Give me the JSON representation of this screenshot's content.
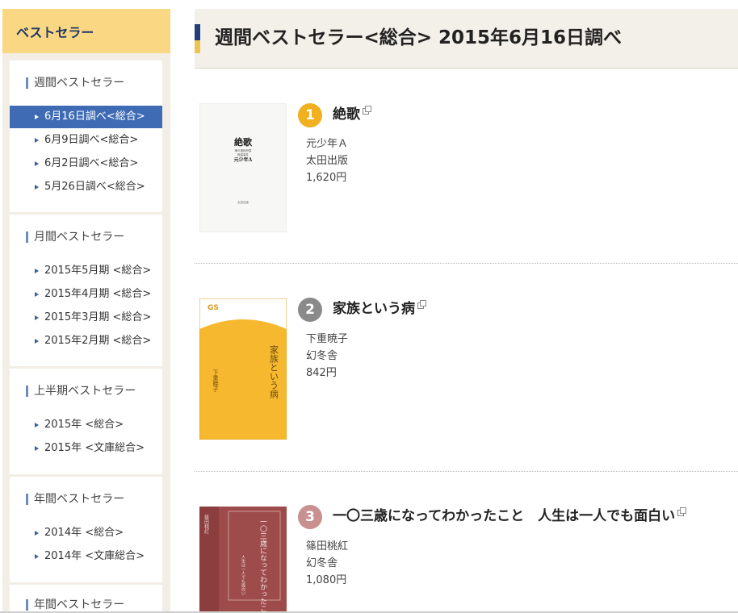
{
  "sidebar": {
    "header": "ベストセラー",
    "sections": [
      {
        "title": "週間ベストセラー",
        "links": [
          "6月16日調べ<総合>",
          "6月9日調べ<総合>",
          "6月2日調べ<総合>",
          "5月26日調べ<総合>"
        ]
      },
      {
        "title": "月間ベストセラー",
        "links": [
          "2015年5月期 <総合>",
          "2015年4月期 <総合>",
          "2015年3月期 <総合>",
          "2015年2月期 <総合>"
        ]
      },
      {
        "title": "上半期ベストセラー",
        "links": [
          "2015年 <総合>",
          "2015年 <文庫総合>"
        ]
      },
      {
        "title": "年間ベストセラー",
        "links": [
          "2014年 <総合>",
          "2014年 <文庫総合>"
        ]
      },
      {
        "title": "年間ベストセラー",
        "links": []
      }
    ],
    "active_link": "6月16日調べ<総合>"
  },
  "main": {
    "title": "週間ベストセラー<総合> 2015年6月16日調べ",
    "books": [
      {
        "rank": "1",
        "title": "絶歌",
        "author": "元少年Ａ",
        "publisher": "太田出版",
        "price": "1,620円",
        "badge_color": "#f0b020",
        "cover": {
          "title": "絶歌",
          "subtitle_line1": "神戸連続児童",
          "subtitle_line2": "殺傷事件",
          "author": "元少年A",
          "publisher": "太田出版"
        }
      },
      {
        "rank": "2",
        "title": "家族という病",
        "author": "下重暁子",
        "publisher": "幻冬舎",
        "price": "842円",
        "badge_color": "#8a8a8a",
        "cover": {
          "series": "GS",
          "title": "家族という病",
          "author": "下重暁子"
        }
      },
      {
        "rank": "3",
        "title": "一〇三歳になってわかったこと　人生は一人でも面白い",
        "author": "篠田桃紅",
        "publisher": "幻冬舎",
        "price": "1,080円",
        "badge_color": "#c99090",
        "cover": {
          "title": "一〇三歳になってわかったこと",
          "subtitle": "人生は一人でも面白い",
          "author": "篠田桃紅"
        }
      }
    ]
  },
  "icons": {
    "external_link": "external-link-icon",
    "bullet": "triangle-right-icon"
  }
}
